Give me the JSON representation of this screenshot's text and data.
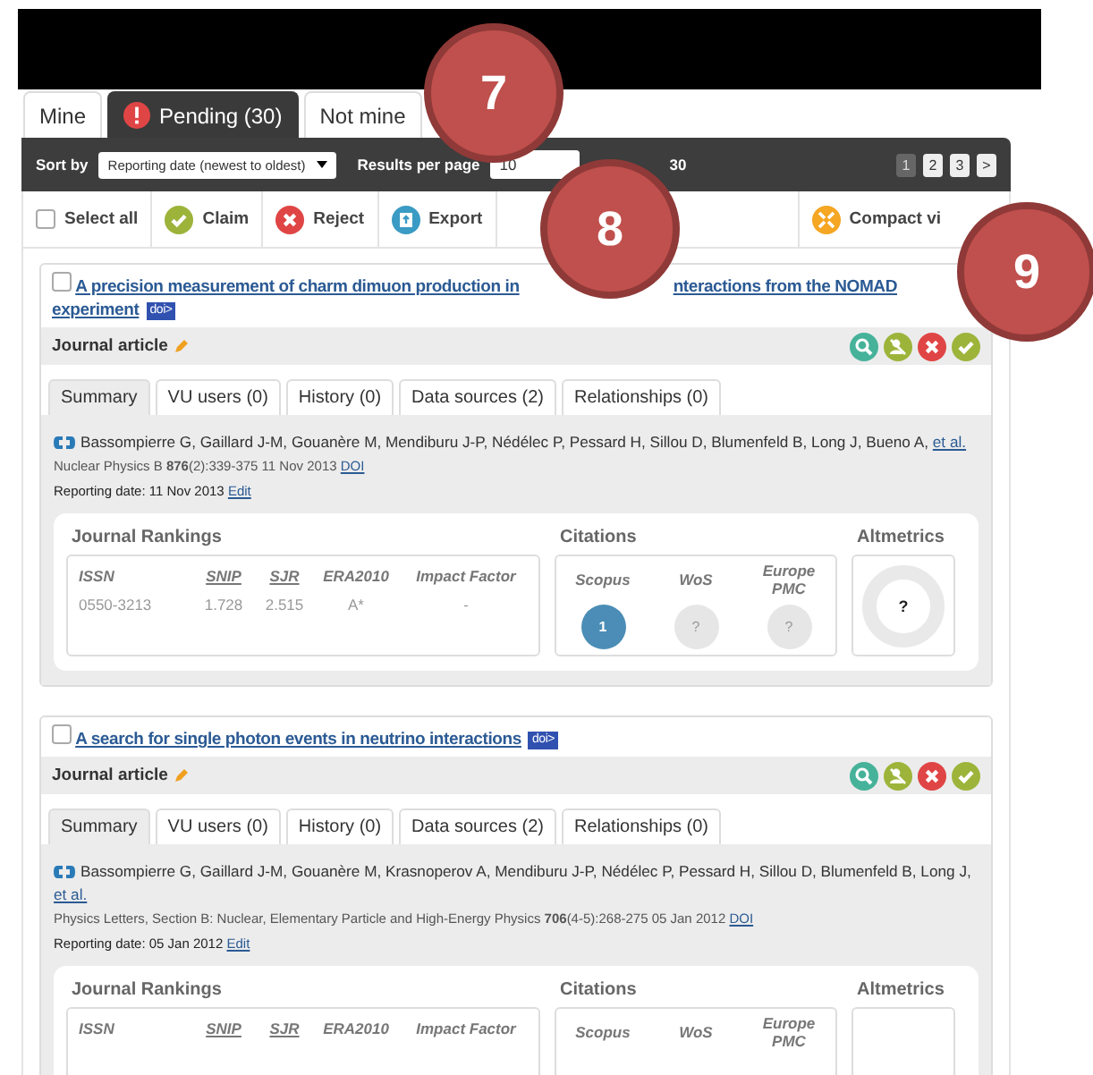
{
  "tabs": [
    {
      "label": "Mine",
      "selected": false,
      "alert": false
    },
    {
      "label": "Pending (30)",
      "selected": true,
      "alert": true
    },
    {
      "label": "Not mine",
      "selected": false,
      "alert": false
    }
  ],
  "toolbar": {
    "sort_label": "Sort by",
    "sort_value": "Reporting date (newest to oldest)",
    "per_page_label": "Results per page",
    "per_page_value": "10",
    "results_text": "30",
    "pages": [
      {
        "label": "1",
        "selected": true
      },
      {
        "label": "2",
        "selected": false
      },
      {
        "label": "3",
        "selected": false
      },
      {
        "label": ">",
        "selected": false
      }
    ]
  },
  "actions": {
    "select_all": {
      "label": "Select all",
      "checked": false
    },
    "buttons": [
      {
        "label": "Claim",
        "kind": "claim"
      },
      {
        "label": "Reject",
        "kind": "reject"
      },
      {
        "label": "Export",
        "kind": "export"
      }
    ],
    "compact": {
      "label": "Compact vi"
    }
  },
  "records": [
    {
      "checked": false,
      "title_parts": [
        "A precision measurement of charm dimuon production in",
        "nteractions from the NOMAD",
        "experiment"
      ],
      "doi_badge": "doi>",
      "type": "Journal article",
      "tabs": [
        {
          "label": "Summary",
          "selected": true
        },
        {
          "label": "VU users (0)",
          "selected": false
        },
        {
          "label": "History (0)",
          "selected": false
        },
        {
          "label": "Data sources (2)",
          "selected": false
        },
        {
          "label": "Relationships (0)",
          "selected": false
        }
      ],
      "authors": "Bassompierre G, Gaillard J-M, Gouanère M, Mendiburu J-P, Nédélec P, Pessard H, Sillou D, Blumenfeld B, Long J, Bueno A,",
      "et_al": "et al.",
      "source": "Nuclear Physics B **876**(2):339-375 11 Nov 2013",
      "doi_link": "DOI",
      "reporting_date": "Reporting date: 11 Nov 2013",
      "edit_link": "Edit",
      "rankings": {
        "title": "Journal Rankings",
        "columns": [
          {
            "label": "ISSN",
            "underlined": false
          },
          {
            "label": "SNIP",
            "underlined": true
          },
          {
            "label": "SJR",
            "underlined": true
          },
          {
            "label": "ERA2010",
            "underlined": false
          },
          {
            "label": "Impact Factor",
            "underlined": false
          }
        ],
        "values": [
          "0550-3213",
          "1.728",
          "2.515",
          "A*",
          "-"
        ]
      },
      "citations": {
        "title": "Citations",
        "sources": [
          {
            "label": "Scopus",
            "value": "1",
            "found": true
          },
          {
            "label": "WoS",
            "value": "?",
            "found": false
          },
          {
            "label": "Europe PMC",
            "value": "?",
            "found": false
          }
        ]
      },
      "altmetrics": {
        "title": "Altmetrics",
        "value": "?"
      }
    },
    {
      "checked": false,
      "title_parts": [
        "A search for single photon events in neutrino interactions"
      ],
      "doi_badge": "doi>",
      "type": "Journal article",
      "tabs": [
        {
          "label": "Summary",
          "selected": true
        },
        {
          "label": "VU users (0)",
          "selected": false
        },
        {
          "label": "History (0)",
          "selected": false
        },
        {
          "label": "Data sources (2)",
          "selected": false
        },
        {
          "label": "Relationships (0)",
          "selected": false
        }
      ],
      "authors": "Bassompierre G, Gaillard J-M, Gouanère M, Krasnoperov A, Mendiburu J-P, Nédélec P, Pessard H, Sillou D, Blumenfeld B, Long J,",
      "et_al": "et al.",
      "source": "Physics Letters, Section B: Nuclear, Elementary Particle and High-Energy Physics **706**(4-5):268-275 05 Jan 2012",
      "doi_link": "DOI",
      "reporting_date": "Reporting date: 05 Jan 2012",
      "edit_link": "Edit",
      "rankings": {
        "title": "Journal Rankings",
        "columns": [
          {
            "label": "ISSN",
            "underlined": false
          },
          {
            "label": "SNIP",
            "underlined": true
          },
          {
            "label": "SJR",
            "underlined": true
          },
          {
            "label": "ERA2010",
            "underlined": false
          },
          {
            "label": "Impact Factor",
            "underlined": false
          }
        ]
      },
      "citations": {
        "title": "Citations",
        "sources": [
          {
            "label": "Scopus"
          },
          {
            "label": "WoS"
          },
          {
            "label": "Europe PMC"
          }
        ]
      },
      "altmetrics": {
        "title": "Altmetrics"
      }
    }
  ],
  "callouts": [
    {
      "label": "7"
    },
    {
      "label": "8"
    },
    {
      "label": "9"
    }
  ]
}
